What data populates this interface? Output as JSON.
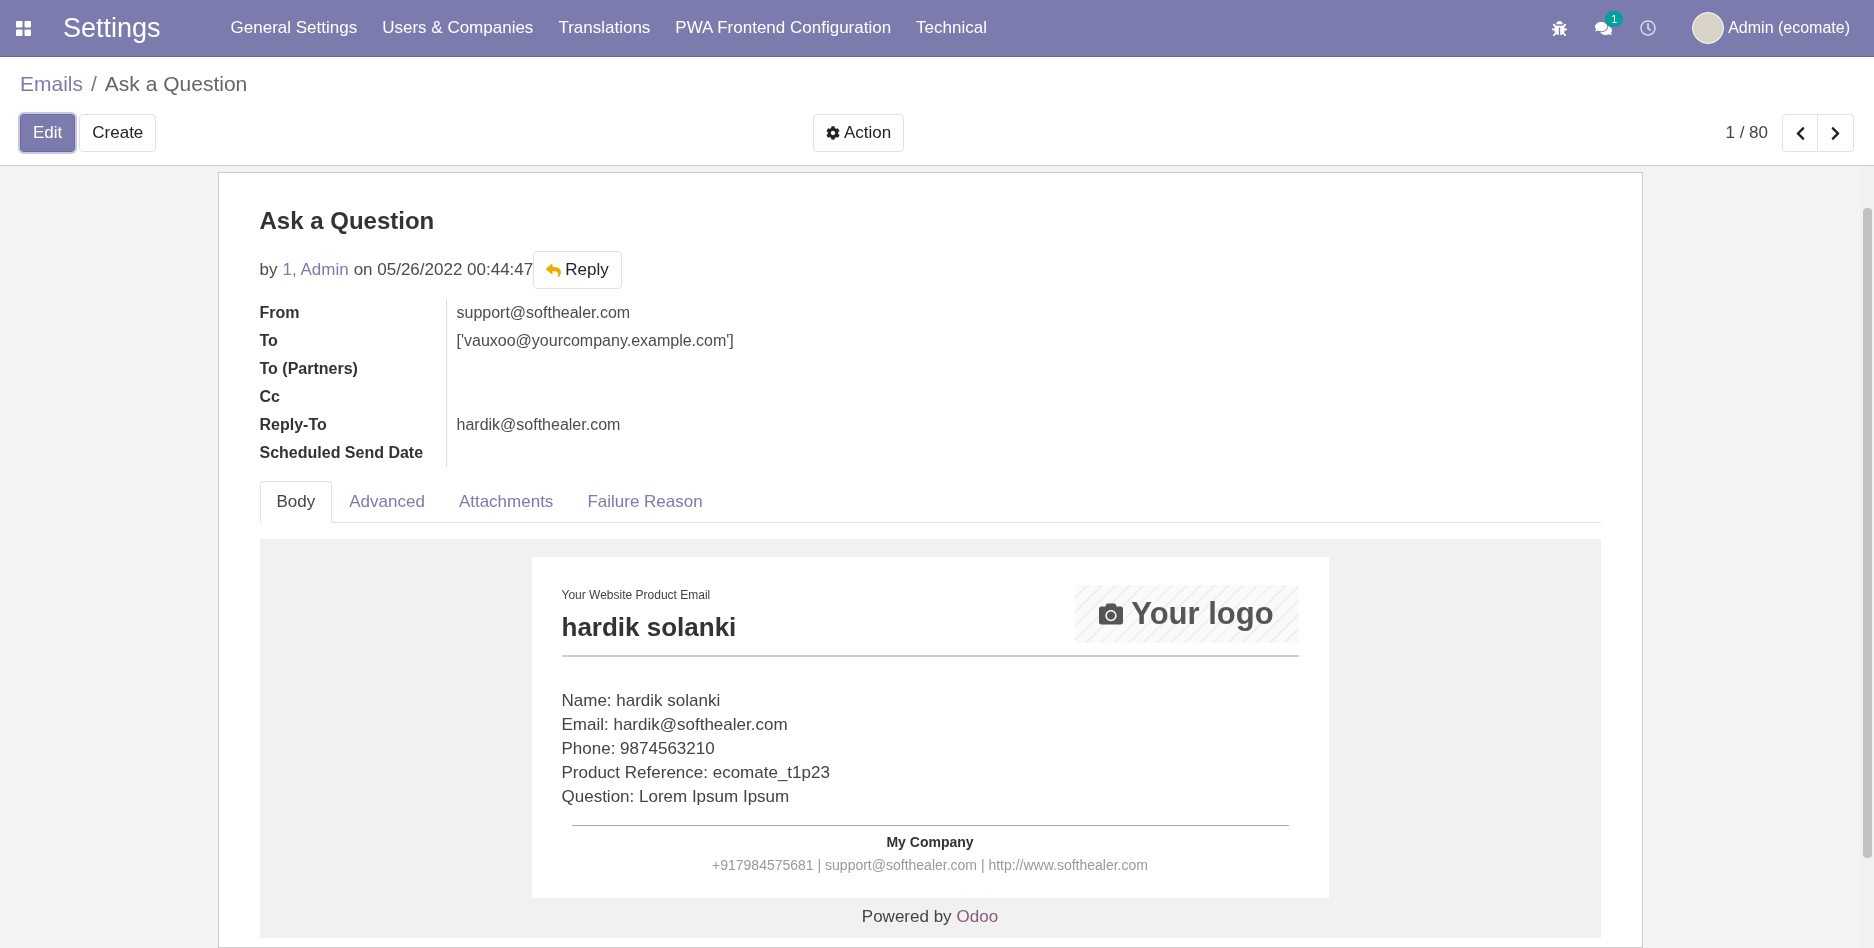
{
  "navbar": {
    "app_name": "Settings",
    "menus": [
      "General Settings",
      "Users & Companies",
      "Translations",
      "PWA Frontend Configuration",
      "Technical"
    ],
    "chat_badge": "1",
    "user": "Admin (ecomate)"
  },
  "breadcrumb": [
    "Emails",
    "Ask a Question"
  ],
  "breadcrumb_separator": "/",
  "buttons": [
    {
      "label": "Edit",
      "kind": "primary"
    },
    {
      "label": "Create",
      "kind": "secondary"
    }
  ],
  "action": "Action",
  "pager": "1 / 80",
  "record": {
    "title": "Ask a Question",
    "by": "by",
    "author": "1, Admin",
    "date": "on 05/26/2022 00:44:47",
    "reply": "Reply"
  },
  "fields": [
    {
      "label": "From",
      "value": "support@softhealer.com"
    },
    {
      "label": "To",
      "value": "['vauxoo@yourcompany.example.com']"
    },
    {
      "label": "To (Partners)"
    },
    {
      "label": "Cc"
    },
    {
      "label": "Reply-To",
      "value": "hardik@softhealer.com"
    },
    {
      "label": "Scheduled Send Date"
    }
  ],
  "tabs": [
    {
      "label": "Body",
      "selected": true
    },
    {
      "label": "Advanced",
      "selected": false
    },
    {
      "label": "Attachments",
      "selected": false
    },
    {
      "label": "Failure Reason",
      "selected": false
    }
  ],
  "email": {
    "subtitle": "Your Website Product Email",
    "heading": "hardik solanki",
    "logo": "Your logo",
    "lines": [
      "Name: hardik solanki",
      "Email: hardik@softhealer.com",
      "Phone: 9874563210",
      "Product Reference: ecomate_t1p23",
      "Question: Lorem Ipsum Ipsum"
    ],
    "company": "My Company",
    "contact": "+917984575681 | support@softhealer.com | http://www.softhealer.com"
  },
  "powered": {
    "prefix": "Powered by",
    "link": "Odoo"
  }
}
